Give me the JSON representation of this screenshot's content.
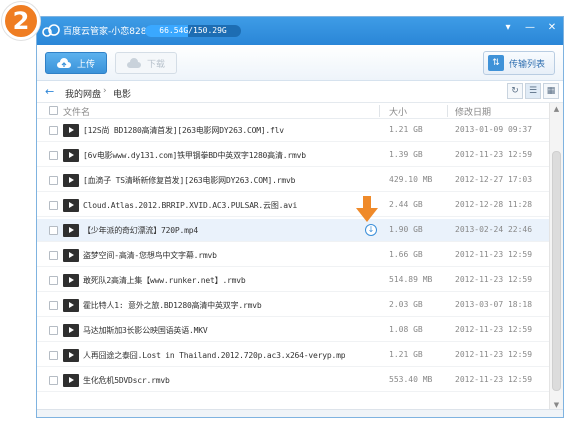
{
  "step_badge": "2",
  "window": {
    "title": "百度云管家-小恋828",
    "quota": {
      "text": "66.54G/150.29G",
      "fraction": 0.443
    },
    "buttons": [
      "minimize",
      "maximize",
      "close"
    ]
  },
  "toolbar": {
    "upload_label": "上传",
    "download_label": "下载",
    "transfer_label": "传输列表"
  },
  "breadcrumb": {
    "root": "我的网盘",
    "current": "电影"
  },
  "list_header": {
    "name": "文件名",
    "size": "大小",
    "date": "修改日期"
  },
  "files": [
    {
      "name": "[12S尚 BD1280高清首发][263电影网DY263.COM].flv",
      "size": "1.21 GB",
      "date": "2013-01-09 09:37"
    },
    {
      "name": "[6v电影www.dy131.com]铁甲钢拳BD中英双字1280高清.rmvb",
      "size": "1.39 GB",
      "date": "2012-11-23 12:59"
    },
    {
      "name": "[血滴子 TS清晰新修复首发][263电影网DY263.COM].rmvb",
      "size": "429.10 MB",
      "date": "2012-12-27 17:03"
    },
    {
      "name": "Cloud.Atlas.2012.BRRIP.XVID.AC3.PULSAR.云图.avi",
      "size": "2.44 GB",
      "date": "2012-12-28 11:28"
    },
    {
      "name": "【少年派的奇幻漂流】720P.mp4",
      "size": "1.90 GB",
      "date": "2013-02-24 22:46"
    },
    {
      "name": "盗梦空间-高清-您想鸟中文字幕.rmvb",
      "size": "1.66 GB",
      "date": "2012-11-23 12:59"
    },
    {
      "name": "敢死队2高清上集【www.runker.net】.rmvb",
      "size": "514.89 MB",
      "date": "2012-11-23 12:59"
    },
    {
      "name": "霍比特人1: 意外之旅.BD1280高清中英双字.rmvb",
      "size": "2.03 GB",
      "date": "2013-03-07 18:18"
    },
    {
      "name": "马达加斯加3长影公映国语英语.MKV",
      "size": "1.08 GB",
      "date": "2012-11-23 12:59"
    },
    {
      "name": "人再囧途之泰囧.Lost in Thailand.2012.720p.ac3.x264-veryp.mp4",
      "size": "1.21 GB",
      "date": "2012-11-23 12:59"
    },
    {
      "name": "生化危机5DVDscr.rmvb",
      "size": "553.40 MB",
      "date": "2012-11-23 12:59"
    }
  ],
  "highlighted_row": 4,
  "colors": {
    "titlebar": "#2a86d7",
    "accent": "#3b93da",
    "badge": "#ef7d22",
    "highlight": "#eaf2fb"
  }
}
